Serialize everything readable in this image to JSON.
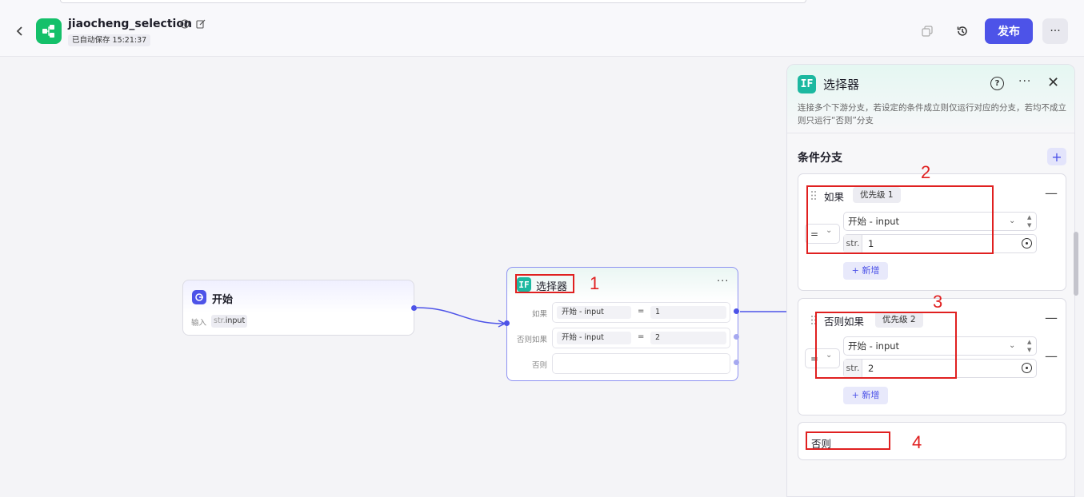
{
  "header": {
    "title": "jiaocheng_selection",
    "autosave": "已自动保存 15:21:37",
    "publish_label": "发布",
    "icons": [
      "back-icon",
      "app-icon",
      "info-icon",
      "edit-icon",
      "copy-icon",
      "history-icon",
      "more-icon"
    ]
  },
  "canvas": {
    "start_node": {
      "title": "开始",
      "input_label": "输入",
      "var_type": "str.",
      "var_name": "input"
    },
    "selector_node": {
      "badge": "IF",
      "title": "选择器",
      "rows": [
        {
          "label": "如果",
          "lhs": "开始  -  input",
          "op": "=",
          "rhs": "1"
        },
        {
          "label": "否则如果",
          "lhs": "开始  -  input",
          "op": "=",
          "rhs": "2"
        },
        {
          "label": "否则",
          "lhs": "",
          "op": "",
          "rhs": ""
        }
      ]
    }
  },
  "panel": {
    "badge": "IF",
    "title": "选择器",
    "help": "?",
    "description": "连接多个下游分支，若设定的条件成立则仅运行对应的分支，若均不成立则只运行“否则”分支",
    "section_title": "条件分支",
    "branches": [
      {
        "label": "如果",
        "priority": "优先级 1",
        "op": "=",
        "left": "开始 - input",
        "type": "str.",
        "value": "1",
        "add_label": "+ 新增"
      },
      {
        "label": "否则如果",
        "priority": "优先级 2",
        "op": "=",
        "left": "开始 - input",
        "type": "str.",
        "value": "2",
        "add_label": "+ 新增"
      }
    ],
    "else_label": "否则"
  },
  "annotations": [
    "1",
    "2",
    "3",
    "4"
  ],
  "colors": {
    "accent": "#4d53e8",
    "brand_green": "#14c06a",
    "if_teal": "#1cb8a0",
    "annotation_red": "#e02020"
  }
}
